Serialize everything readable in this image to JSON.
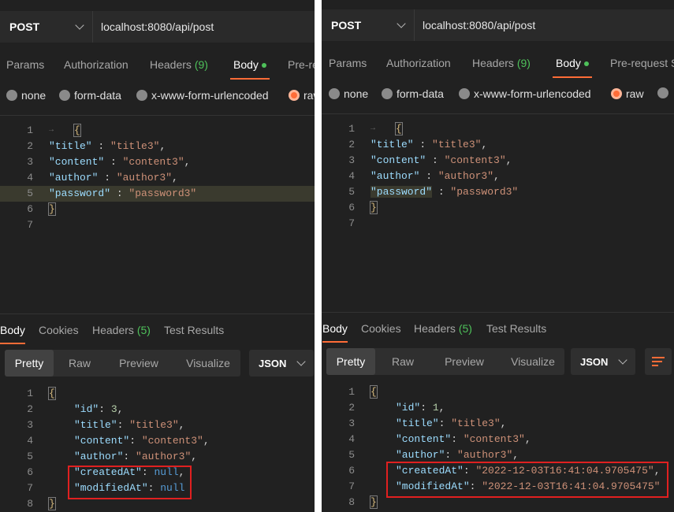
{
  "panels": [
    {
      "method": "POST",
      "url": "localhost:8080/api/post",
      "tabs": {
        "params": "Params",
        "authorization": "Authorization",
        "headers": "Headers",
        "headers_count": "(9)",
        "body": "Body",
        "prerequest": "Pre-re"
      },
      "body_options": {
        "none": "none",
        "form_data": "form-data",
        "urlencoded": "x-www-form-urlencoded",
        "raw": "raw"
      },
      "request_lines": [
        "1",
        "2",
        "3",
        "4",
        "5",
        "6",
        "7"
      ],
      "request": {
        "title_key": "\"title\"",
        "title_val": "\"title3\"",
        "content_key": "\"content\"",
        "content_val": "\"content3\"",
        "author_key": "\"author\"",
        "author_val": "\"author3\"",
        "password_key": "\"password\"",
        "password_val": "\"password3\""
      },
      "response_tabs": {
        "body": "Body",
        "cookies": "Cookies",
        "headers": "Headers",
        "headers_count": "(5)",
        "test_results": "Test Results"
      },
      "view_modes": {
        "pretty": "Pretty",
        "raw": "Raw",
        "preview": "Preview",
        "visualize": "Visualize"
      },
      "format": "JSON",
      "response_lines": [
        "1",
        "2",
        "3",
        "4",
        "5",
        "6",
        "7",
        "8"
      ],
      "response": {
        "id_key": "\"id\"",
        "id_val": "3",
        "title_key": "\"title\"",
        "title_val": "\"title3\"",
        "content_key": "\"content\"",
        "content_val": "\"content3\"",
        "author_key": "\"author\"",
        "author_val": "\"author3\"",
        "created_key": "\"createdAt\"",
        "created_val": "null",
        "modified_key": "\"modifiedAt\"",
        "modified_val": "null"
      }
    },
    {
      "method": "POST",
      "url": "localhost:8080/api/post",
      "tabs": {
        "params": "Params",
        "authorization": "Authorization",
        "headers": "Headers",
        "headers_count": "(9)",
        "body": "Body",
        "prerequest": "Pre-request S"
      },
      "body_options": {
        "none": "none",
        "form_data": "form-data",
        "urlencoded": "x-www-form-urlencoded",
        "raw": "raw"
      },
      "request_lines": [
        "1",
        "2",
        "3",
        "4",
        "5",
        "6",
        "7"
      ],
      "request": {
        "title_key": "\"title\"",
        "title_val": "\"title3\"",
        "content_key": "\"content\"",
        "content_val": "\"content3\"",
        "author_key": "\"author\"",
        "author_val": "\"author3\"",
        "password_key": "\"password\"",
        "password_val": "\"password3\""
      },
      "response_tabs": {
        "body": "Body",
        "cookies": "Cookies",
        "headers": "Headers",
        "headers_count": "(5)",
        "test_results": "Test Results"
      },
      "view_modes": {
        "pretty": "Pretty",
        "raw": "Raw",
        "preview": "Preview",
        "visualize": "Visualize"
      },
      "format": "JSON",
      "response_lines": [
        "1",
        "2",
        "3",
        "4",
        "5",
        "6",
        "7",
        "8"
      ],
      "response": {
        "id_key": "\"id\"",
        "id_val": "1",
        "title_key": "\"title\"",
        "title_val": "\"title3\"",
        "content_key": "\"content\"",
        "content_val": "\"content3\"",
        "author_key": "\"author\"",
        "author_val": "\"author3\"",
        "created_key": "\"createdAt\"",
        "created_val": "\"2022-12-03T16:41:04.9705475\"",
        "modified_key": "\"modifiedAt\"",
        "modified_val": "\"2022-12-03T16:41:04.9705475\""
      }
    }
  ],
  "colors": {
    "accent": "#ff6c37",
    "highlight_box": "#e02020",
    "count_green": "#4ec15a",
    "background": "#212121"
  }
}
